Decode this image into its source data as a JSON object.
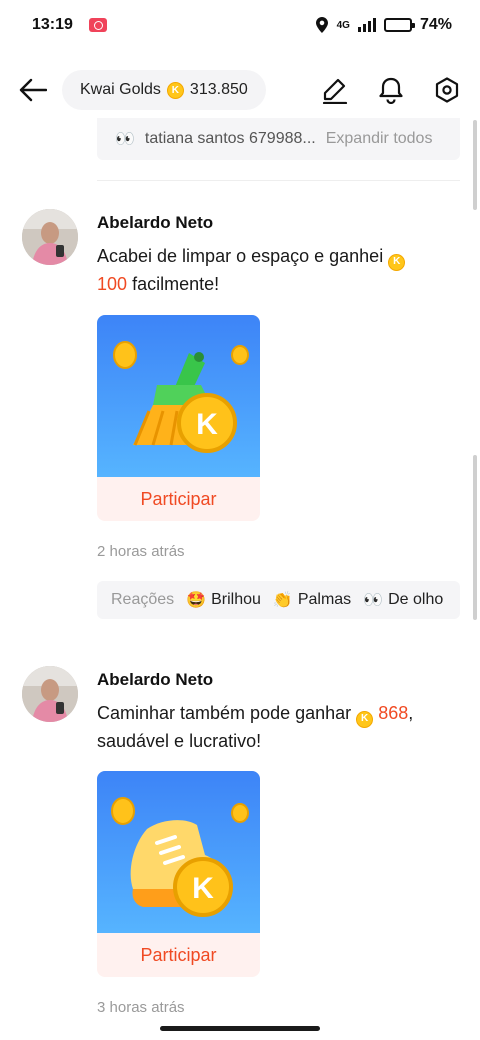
{
  "status_bar": {
    "time": "13:19",
    "network": "4G",
    "battery": "74%",
    "battery_level": 0.74
  },
  "top_bar": {
    "gold_label": "Kwai Golds",
    "gold_amount": "313.850",
    "coin_letter": "K",
    "icons": [
      "back-arrow-icon",
      "edit-icon",
      "bell-icon",
      "settings-icon"
    ]
  },
  "prev_comment": {
    "emoji": "👀",
    "text": "tatiana santos 679988...",
    "expand": "Expandir todos"
  },
  "posts": [
    {
      "author": "Abelardo Neto",
      "text_before": "Acabei de limpar o espaço e ganhei",
      "amount": "100",
      "text_after": "facilmente!",
      "button": "Participar",
      "time": "2 horas atrás",
      "image": "broom-coin"
    },
    {
      "author": "Abelardo Neto",
      "text_before": "Caminhar também pode ganhar",
      "amount": "868",
      "text_after": ", saudável e lucrativo!",
      "button": "Participar",
      "time": "3 horas atrás",
      "image": "sneaker-coin"
    }
  ],
  "reactions": {
    "label": "Reações",
    "items": [
      {
        "emoji": "🤩",
        "label": "Brilhou"
      },
      {
        "emoji": "👏",
        "label": "Palmas"
      },
      {
        "emoji": "👀",
        "label": "De olho"
      }
    ]
  },
  "colors": {
    "accent": "#f04a23",
    "coin": "#ffc61a",
    "card_top": "#3d84f7",
    "card_bottom": "#56b4ff"
  }
}
